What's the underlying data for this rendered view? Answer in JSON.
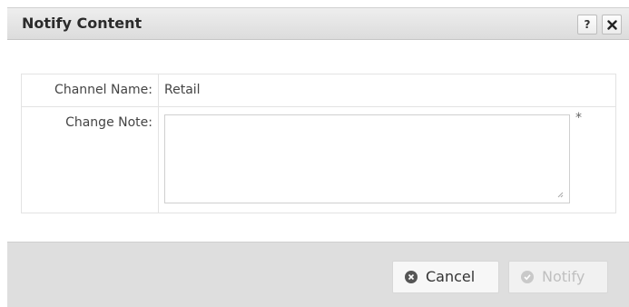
{
  "dialog": {
    "title": "Notify Content",
    "help_label": "?"
  },
  "form": {
    "channel_label": "Channel Name:",
    "channel_value": "Retail",
    "note_label": "Change Note:",
    "note_value": "",
    "required_marker": "*"
  },
  "buttons": {
    "cancel_label": "Cancel",
    "notify_label": "Notify"
  }
}
